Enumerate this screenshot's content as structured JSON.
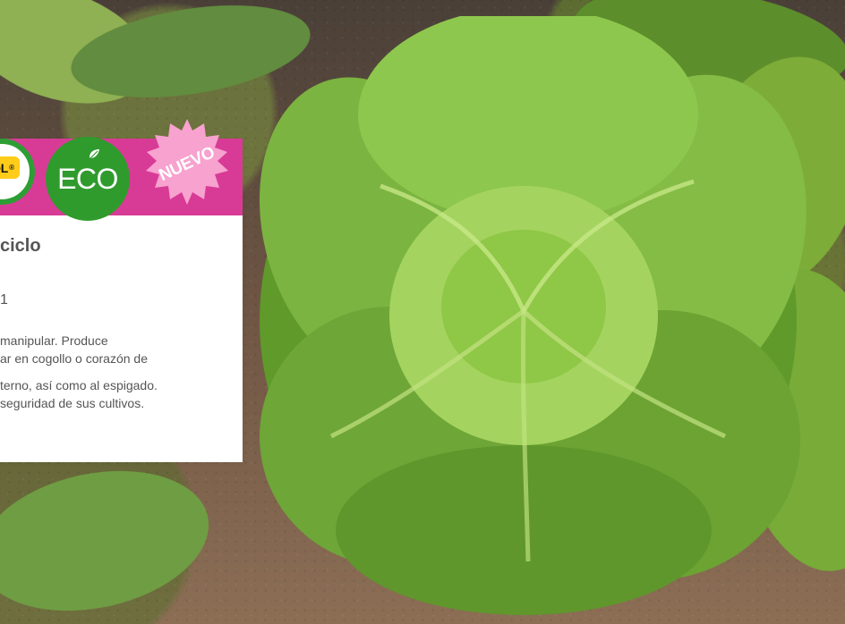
{
  "card": {
    "badges": {
      "control_text": "ROL",
      "control_reg": "®",
      "eco_label": "ECO",
      "nuevo_label": "NUEVO"
    },
    "title": "ciclo",
    "code": "1",
    "description_lines": [
      "manipular. Produce",
      "ar en cogollo o corazón de",
      "terno, así como al espigado.",
      "seguridad de sus cultivos."
    ]
  },
  "colors": {
    "accent_pink": "#d83b96",
    "eco_green": "#2f9b2d",
    "control_yellow": "#ffcc1a",
    "text_gray": "#555555"
  },
  "icons": {
    "eco": "leaf-icon",
    "new": "burst-badge-icon"
  }
}
